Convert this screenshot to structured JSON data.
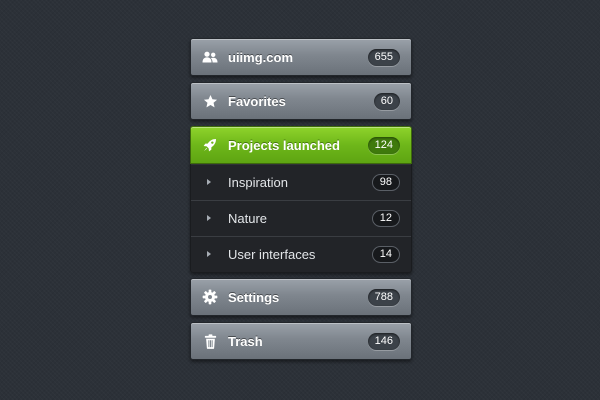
{
  "menu": {
    "items": [
      {
        "label": "uiimg.com",
        "count": "655",
        "icon": "users-icon"
      },
      {
        "label": "Favorites",
        "count": "60",
        "icon": "star-icon"
      },
      {
        "label": "Projects launched",
        "count": "124",
        "icon": "rocket-icon",
        "active": true,
        "children": [
          {
            "label": "Inspiration",
            "count": "98"
          },
          {
            "label": "Nature",
            "count": "12"
          },
          {
            "label": "User interfaces",
            "count": "14"
          }
        ]
      },
      {
        "label": "Settings",
        "count": "788",
        "icon": "gear-icon"
      },
      {
        "label": "Trash",
        "count": "146",
        "icon": "trash-icon"
      }
    ]
  },
  "colors": {
    "background": "#2c3138",
    "active_green": "#6eb71a",
    "item_gray": "#7f868e",
    "submenu_dark": "#222428"
  }
}
